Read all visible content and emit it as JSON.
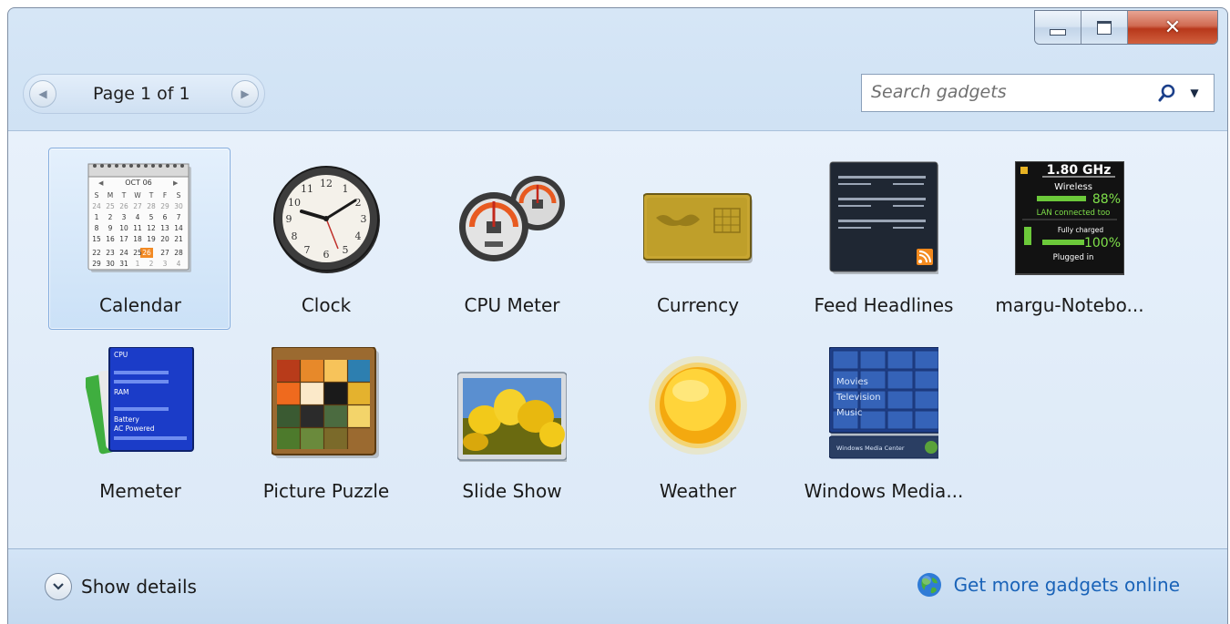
{
  "window": {
    "caption_buttons": {
      "minimize": "minimize-icon",
      "maximize": "maximize-icon",
      "close": "close-icon"
    }
  },
  "toolbar": {
    "page_text": "Page 1 of 1",
    "prev_icon": "chevron-left-icon",
    "next_icon": "chevron-right-icon"
  },
  "search": {
    "placeholder": "Search gadgets",
    "icon": "search-icon",
    "dropdown_icon": "dropdown-arrow-icon"
  },
  "gadgets": [
    {
      "name": "Calendar",
      "icon": "calendar-icon",
      "selected": true
    },
    {
      "name": "Clock",
      "icon": "clock-icon"
    },
    {
      "name": "CPU Meter",
      "icon": "cpu-meter-icon"
    },
    {
      "name": "Currency",
      "icon": "currency-icon"
    },
    {
      "name": "Feed Headlines",
      "icon": "feed-headlines-icon"
    },
    {
      "name": "margu-Notebo...",
      "icon": "notebook-status-icon"
    },
    {
      "name": "Memeter",
      "icon": "memeter-icon"
    },
    {
      "name": "Picture Puzzle",
      "icon": "picture-puzzle-icon"
    },
    {
      "name": "Slide Show",
      "icon": "slide-show-icon"
    },
    {
      "name": "Weather",
      "icon": "weather-icon"
    },
    {
      "name": "Windows Media...",
      "icon": "windows-media-icon"
    }
  ],
  "gadget_content": {
    "calendar": {
      "month": "OCT 06",
      "weekdays": [
        "S",
        "M",
        "T",
        "W",
        "T",
        "F",
        "S"
      ],
      "rows": [
        [
          "24",
          "25",
          "26",
          "27",
          "28",
          "29",
          "30"
        ],
        [
          "1",
          "2",
          "3",
          "4",
          "5",
          "6",
          "7"
        ],
        [
          "8",
          "9",
          "10",
          "11",
          "12",
          "13",
          "14"
        ],
        [
          "15",
          "16",
          "17",
          "18",
          "19",
          "20",
          "21"
        ],
        [
          "22",
          "23",
          "24",
          "25",
          "26",
          "27",
          "28"
        ],
        [
          "29",
          "30",
          "31",
          "1",
          "2",
          "3",
          "4"
        ]
      ]
    },
    "clock": {
      "numbers": [
        "12",
        "1",
        "2",
        "3",
        "4",
        "5",
        "6",
        "7",
        "8",
        "9",
        "10",
        "11"
      ]
    },
    "notebook": {
      "speed": "1.80 GHz",
      "network": "Wireless",
      "signal": "88%",
      "lan": "LAN connected too",
      "battery_state": "Fully charged",
      "battery": "100%",
      "power": "Plugged in"
    },
    "memeter": {
      "cpu": "CPU",
      "ram": "RAM",
      "battery": "Battery",
      "power": "AC Powered"
    },
    "media_center": {
      "items": [
        "Movies",
        "Television",
        "Music"
      ],
      "brand": "Windows Media Center"
    }
  },
  "footer": {
    "show_details": "Show details",
    "get_more": "Get more gadgets online"
  },
  "colors": {
    "link": "#1a63b8",
    "selection_border": "#84acdd"
  }
}
